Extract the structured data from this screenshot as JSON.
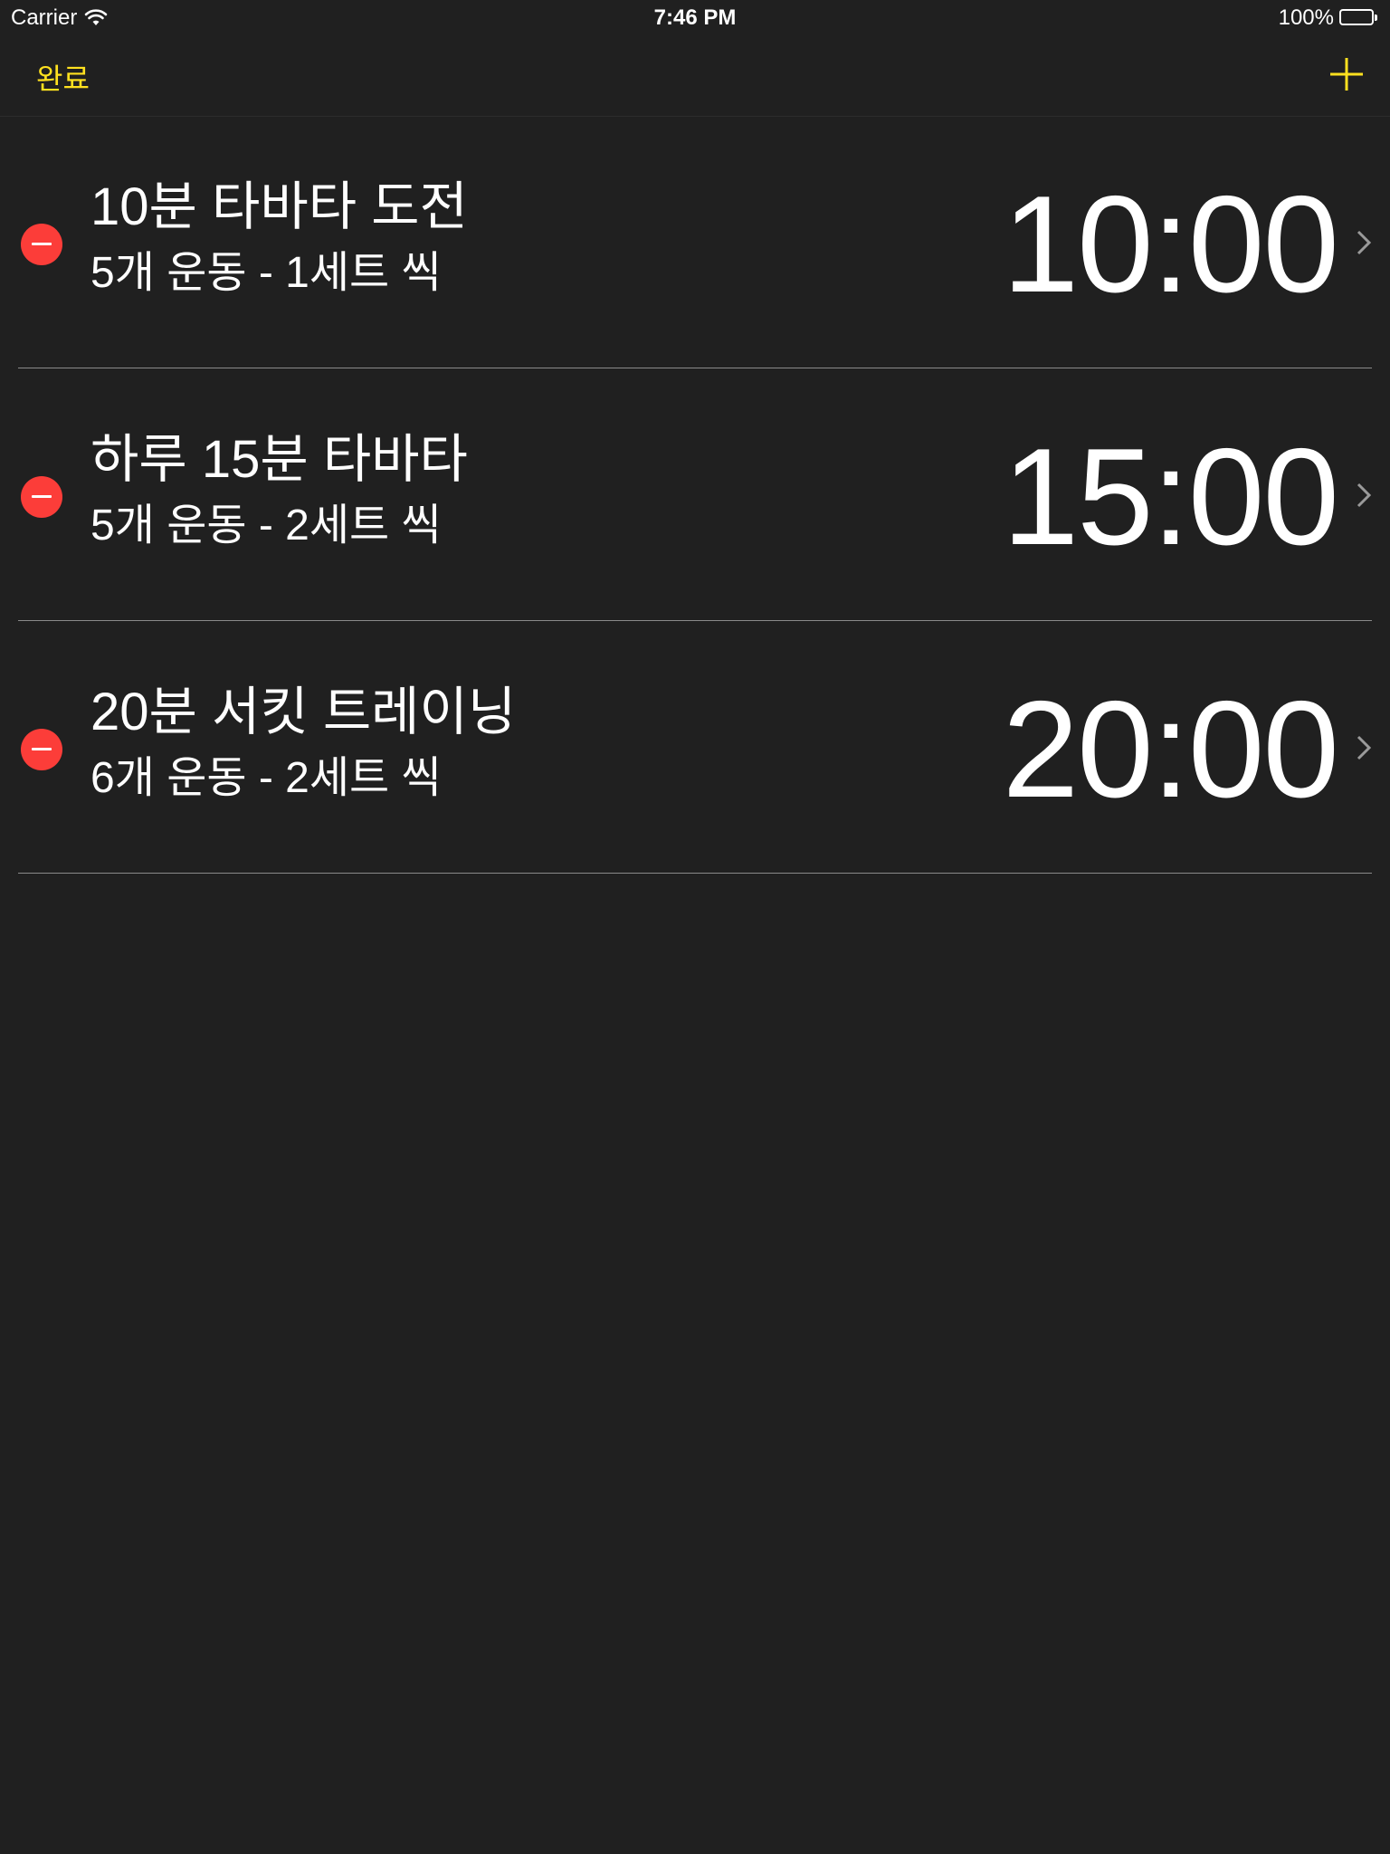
{
  "status_bar": {
    "carrier": "Carrier",
    "time": "7:46 PM",
    "battery": "100%",
    "battery_level": 1.0
  },
  "nav": {
    "done_label": "완료",
    "add_icon": "plus-icon",
    "accent_color": "#ffe11f"
  },
  "workouts": [
    {
      "title": "10분 타바타 도전",
      "subtitle": "5개 운동 - 1세트 씩",
      "duration": "10:00"
    },
    {
      "title": "하루 15분 타바타",
      "subtitle": "5개 운동 - 2세트 씩",
      "duration": "15:00"
    },
    {
      "title": "20분 서킷 트레이닝",
      "subtitle": "6개 운동 - 2세트 씩",
      "duration": "20:00"
    }
  ],
  "colors": {
    "background": "#202020",
    "delete": "#fc3d39",
    "text": "#ffffff"
  }
}
